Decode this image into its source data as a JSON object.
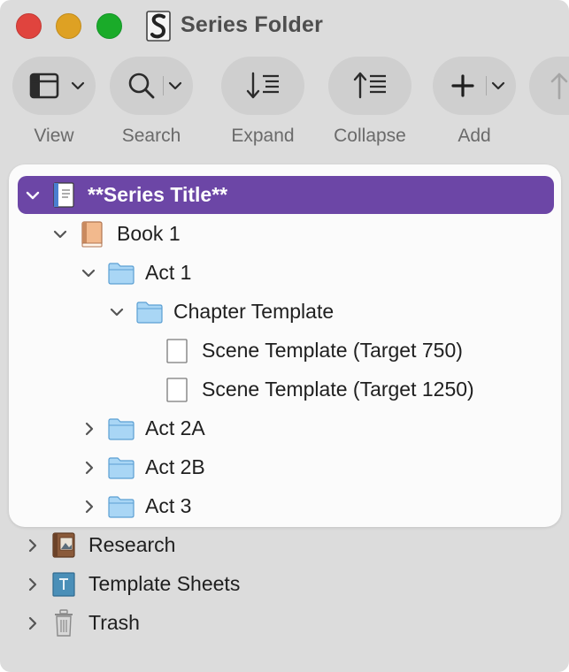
{
  "window": {
    "title": "Series Folder"
  },
  "toolbar": {
    "items": [
      {
        "label": "View",
        "icon": "sidebar-layout-icon"
      },
      {
        "label": "Search",
        "icon": "magnifier-icon"
      },
      {
        "label": "Expand",
        "icon": "expand-arrow-icon"
      },
      {
        "label": "Collapse",
        "icon": "collapse-arrow-icon"
      },
      {
        "label": "Add",
        "icon": "plus-icon"
      }
    ]
  },
  "binder": {
    "items": [
      {
        "label": "**Series Title**",
        "icon": "document-icon",
        "expanded": true,
        "selected": true
      },
      {
        "label": "Book 1",
        "icon": "book-icon",
        "expanded": true
      },
      {
        "label": "Act 1",
        "icon": "folder-icon",
        "expanded": true
      },
      {
        "label": "Chapter Template",
        "icon": "folder-icon",
        "expanded": true
      },
      {
        "label": "Scene Template (Target 750)",
        "icon": "blank-page-icon"
      },
      {
        "label": "Scene Template (Target 1250)",
        "icon": "blank-page-icon"
      },
      {
        "label": "Act 2A",
        "icon": "folder-icon",
        "expanded": false
      },
      {
        "label": "Act 2B",
        "icon": "folder-icon",
        "expanded": false
      },
      {
        "label": "Act 3",
        "icon": "folder-icon",
        "expanded": false
      }
    ],
    "root_items": [
      {
        "label": "Research",
        "icon": "research-icon",
        "expanded": false
      },
      {
        "label": "Template Sheets",
        "icon": "template-sheets-icon",
        "expanded": false
      },
      {
        "label": "Trash",
        "icon": "trash-icon",
        "expanded": false
      }
    ]
  },
  "colors": {
    "selection": "#6c46a6",
    "folder": "#a9d6f5",
    "window_bg": "#dcdcdc"
  }
}
